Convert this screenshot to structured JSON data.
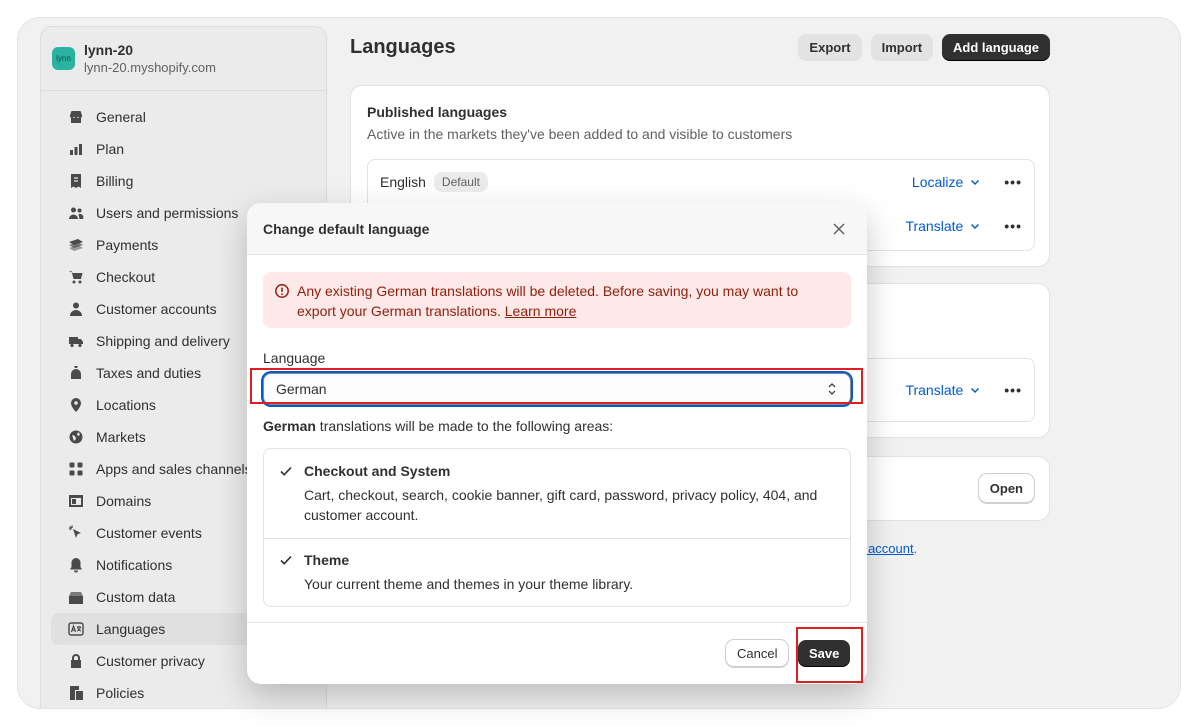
{
  "store": {
    "logo_text": "lynn",
    "name": "lynn-20",
    "url": "lynn-20.myshopify.com"
  },
  "sidebar": {
    "items": [
      {
        "label": "General",
        "icon": "store-icon"
      },
      {
        "label": "Plan",
        "icon": "plan-icon"
      },
      {
        "label": "Billing",
        "icon": "billing-icon"
      },
      {
        "label": "Users and permissions",
        "icon": "users-icon"
      },
      {
        "label": "Payments",
        "icon": "payments-icon"
      },
      {
        "label": "Checkout",
        "icon": "cart-icon"
      },
      {
        "label": "Customer accounts",
        "icon": "person-icon"
      },
      {
        "label": "Shipping and delivery",
        "icon": "truck-icon"
      },
      {
        "label": "Taxes and duties",
        "icon": "tax-icon"
      },
      {
        "label": "Locations",
        "icon": "location-icon"
      },
      {
        "label": "Markets",
        "icon": "globe-icon"
      },
      {
        "label": "Apps and sales channels",
        "icon": "apps-icon"
      },
      {
        "label": "Domains",
        "icon": "domains-icon"
      },
      {
        "label": "Customer events",
        "icon": "cursor-icon"
      },
      {
        "label": "Notifications",
        "icon": "bell-icon"
      },
      {
        "label": "Custom data",
        "icon": "database-icon"
      },
      {
        "label": "Languages",
        "icon": "language-icon",
        "active": true
      },
      {
        "label": "Customer privacy",
        "icon": "lock-icon"
      },
      {
        "label": "Policies",
        "icon": "policies-icon"
      }
    ]
  },
  "page": {
    "title": "Languages",
    "actions": {
      "export": "Export",
      "import": "Import",
      "add_language": "Add language"
    }
  },
  "published": {
    "title": "Published languages",
    "subtitle": "Active in the markets they've been added to and visible to customers",
    "row1": {
      "language": "English",
      "badge": "Default",
      "action": "Localize"
    },
    "row2": {
      "action": "Translate"
    }
  },
  "second_card": {
    "row": {
      "action": "Translate"
    }
  },
  "third_card": {
    "button": "Open"
  },
  "footnote": {
    "link": "ge account",
    "suffix": "."
  },
  "modal": {
    "title": "Change default language",
    "banner": {
      "text": "Any existing German translations will be deleted. Before saving, you may want to export your German translations. ",
      "link": "Learn more"
    },
    "field_label": "Language",
    "selected_language": "German",
    "areas_intro_bold": "German",
    "areas_intro_rest": " translations will be made to the following areas:",
    "areas": [
      {
        "title": "Checkout and System",
        "description": "Cart, checkout, search, cookie banner, gift card, password, privacy policy, 404, and customer account."
      },
      {
        "title": "Theme",
        "description": "Your current theme and themes in your theme library."
      }
    ],
    "cancel": "Cancel",
    "save": "Save"
  }
}
